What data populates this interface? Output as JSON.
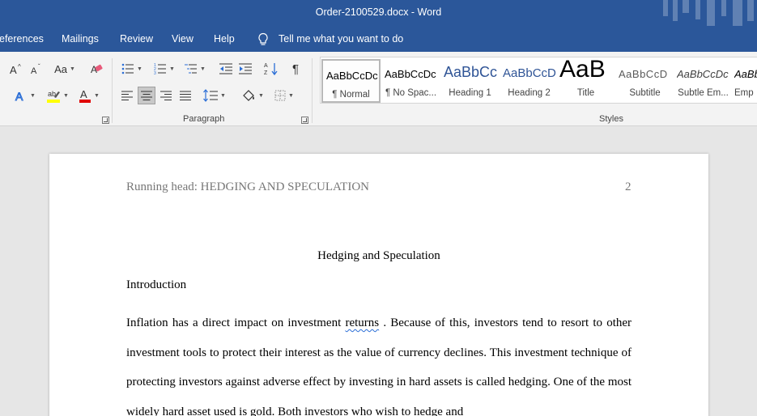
{
  "window": {
    "title": "Order-2100529.docx  -  Word"
  },
  "tabs": [
    {
      "label": "eferences"
    },
    {
      "label": "Mailings"
    },
    {
      "label": "Review"
    },
    {
      "label": "View"
    },
    {
      "label": "Help"
    }
  ],
  "tell_me": {
    "text": "Tell me what you want to do"
  },
  "ribbon": {
    "font_group": {
      "change_case": "Aa"
    },
    "paragraph_group": {
      "label": "Paragraph"
    },
    "styles_group": {
      "label": "Styles",
      "items": [
        {
          "sample": "AaBbCcDc",
          "label": "¶ Normal"
        },
        {
          "sample": "AaBbCcDc",
          "label": "¶ No Spac..."
        },
        {
          "sample": "AaBbCc",
          "label": "Heading 1"
        },
        {
          "sample": "AaBbCcD",
          "label": "Heading 2"
        },
        {
          "sample": "AaB",
          "label": "Title"
        },
        {
          "sample": "AaBbCcD",
          "label": "Subtitle"
        },
        {
          "sample": "AaBbCcDc",
          "label": "Subtle Em..."
        },
        {
          "sample": "AaBb",
          "label": "Emp"
        }
      ]
    }
  },
  "colors": {
    "accent": "#2b579a",
    "highlight": "#ffff00",
    "font_color": "#e00000"
  },
  "document": {
    "header": "Running head: HEDGING AND SPECULATION",
    "page_number": "2",
    "title": "Hedging and Speculation",
    "section": "Introduction",
    "p1_a": "Inflation has a direct impact on investment ",
    "p1_b": "returns",
    "p1_c": " . Because of this, investors tend to resort to other investment tools to protect their interest as the value of currency declines. This investment technique of protecting investors against adverse effect by investing in hard assets is called hedging. One of the most widely hard ",
    "p1_d": "asset",
    "p1_e": " used is gold. Both investors who wish to hedge and"
  }
}
